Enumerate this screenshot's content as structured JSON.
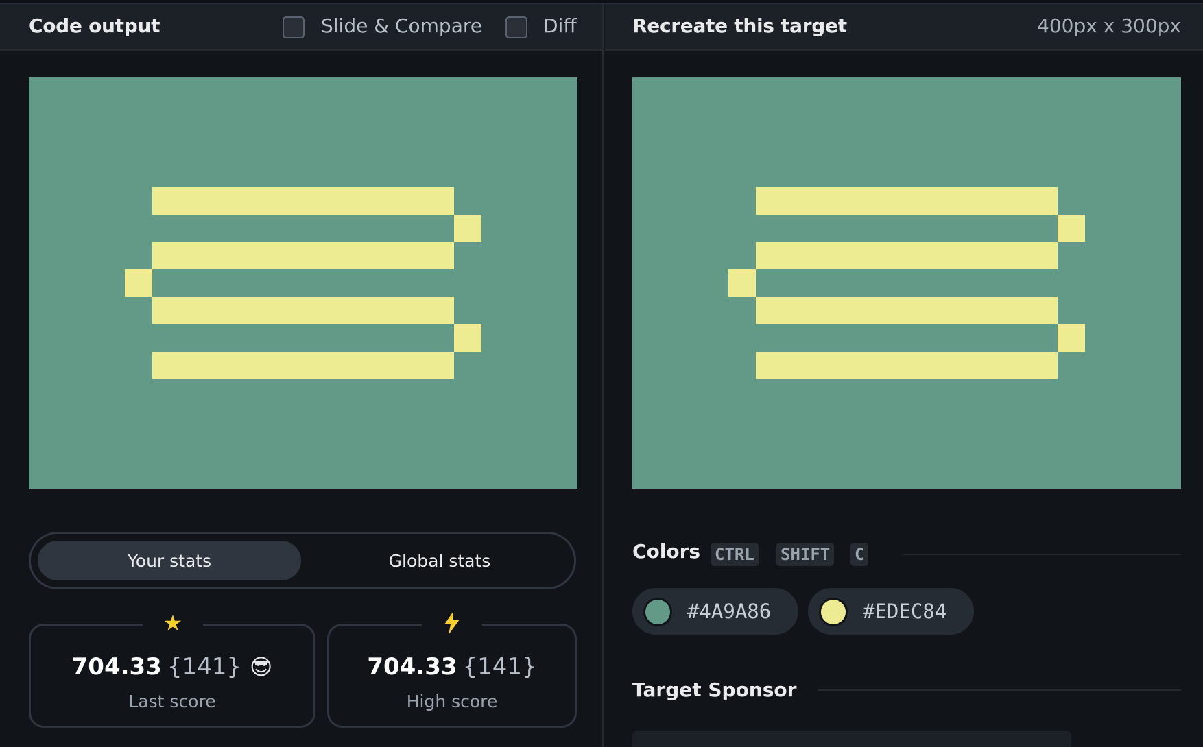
{
  "left_panel": {
    "title": "Code output",
    "slide_compare_label": "Slide & Compare",
    "diff_label": "Diff"
  },
  "right_panel": {
    "title": "Recreate this target",
    "dimensions": "400px x 300px"
  },
  "stats_toggle": {
    "your_stats": "Your stats",
    "global_stats": "Global stats"
  },
  "last_score": {
    "icon": "star-icon",
    "value": "704.33",
    "count": "{141}",
    "emoji": "😎",
    "label": "Last score"
  },
  "high_score": {
    "icon": "lightning-icon",
    "value": "704.33",
    "count": "{141}",
    "label": "High score"
  },
  "colors_section": {
    "title": "Colors",
    "shortcut_keys": [
      "CTRL",
      "SHIFT",
      "C"
    ],
    "swatches": [
      {
        "hex": "#4A9A86",
        "color": "#629a87"
      },
      {
        "hex": "#EDEC84",
        "color": "#edec92"
      }
    ]
  },
  "sponsor_section": {
    "title": "Target Sponsor"
  },
  "theme": {
    "canvas_background": "#629a87",
    "bar_color": "#edec92"
  }
}
